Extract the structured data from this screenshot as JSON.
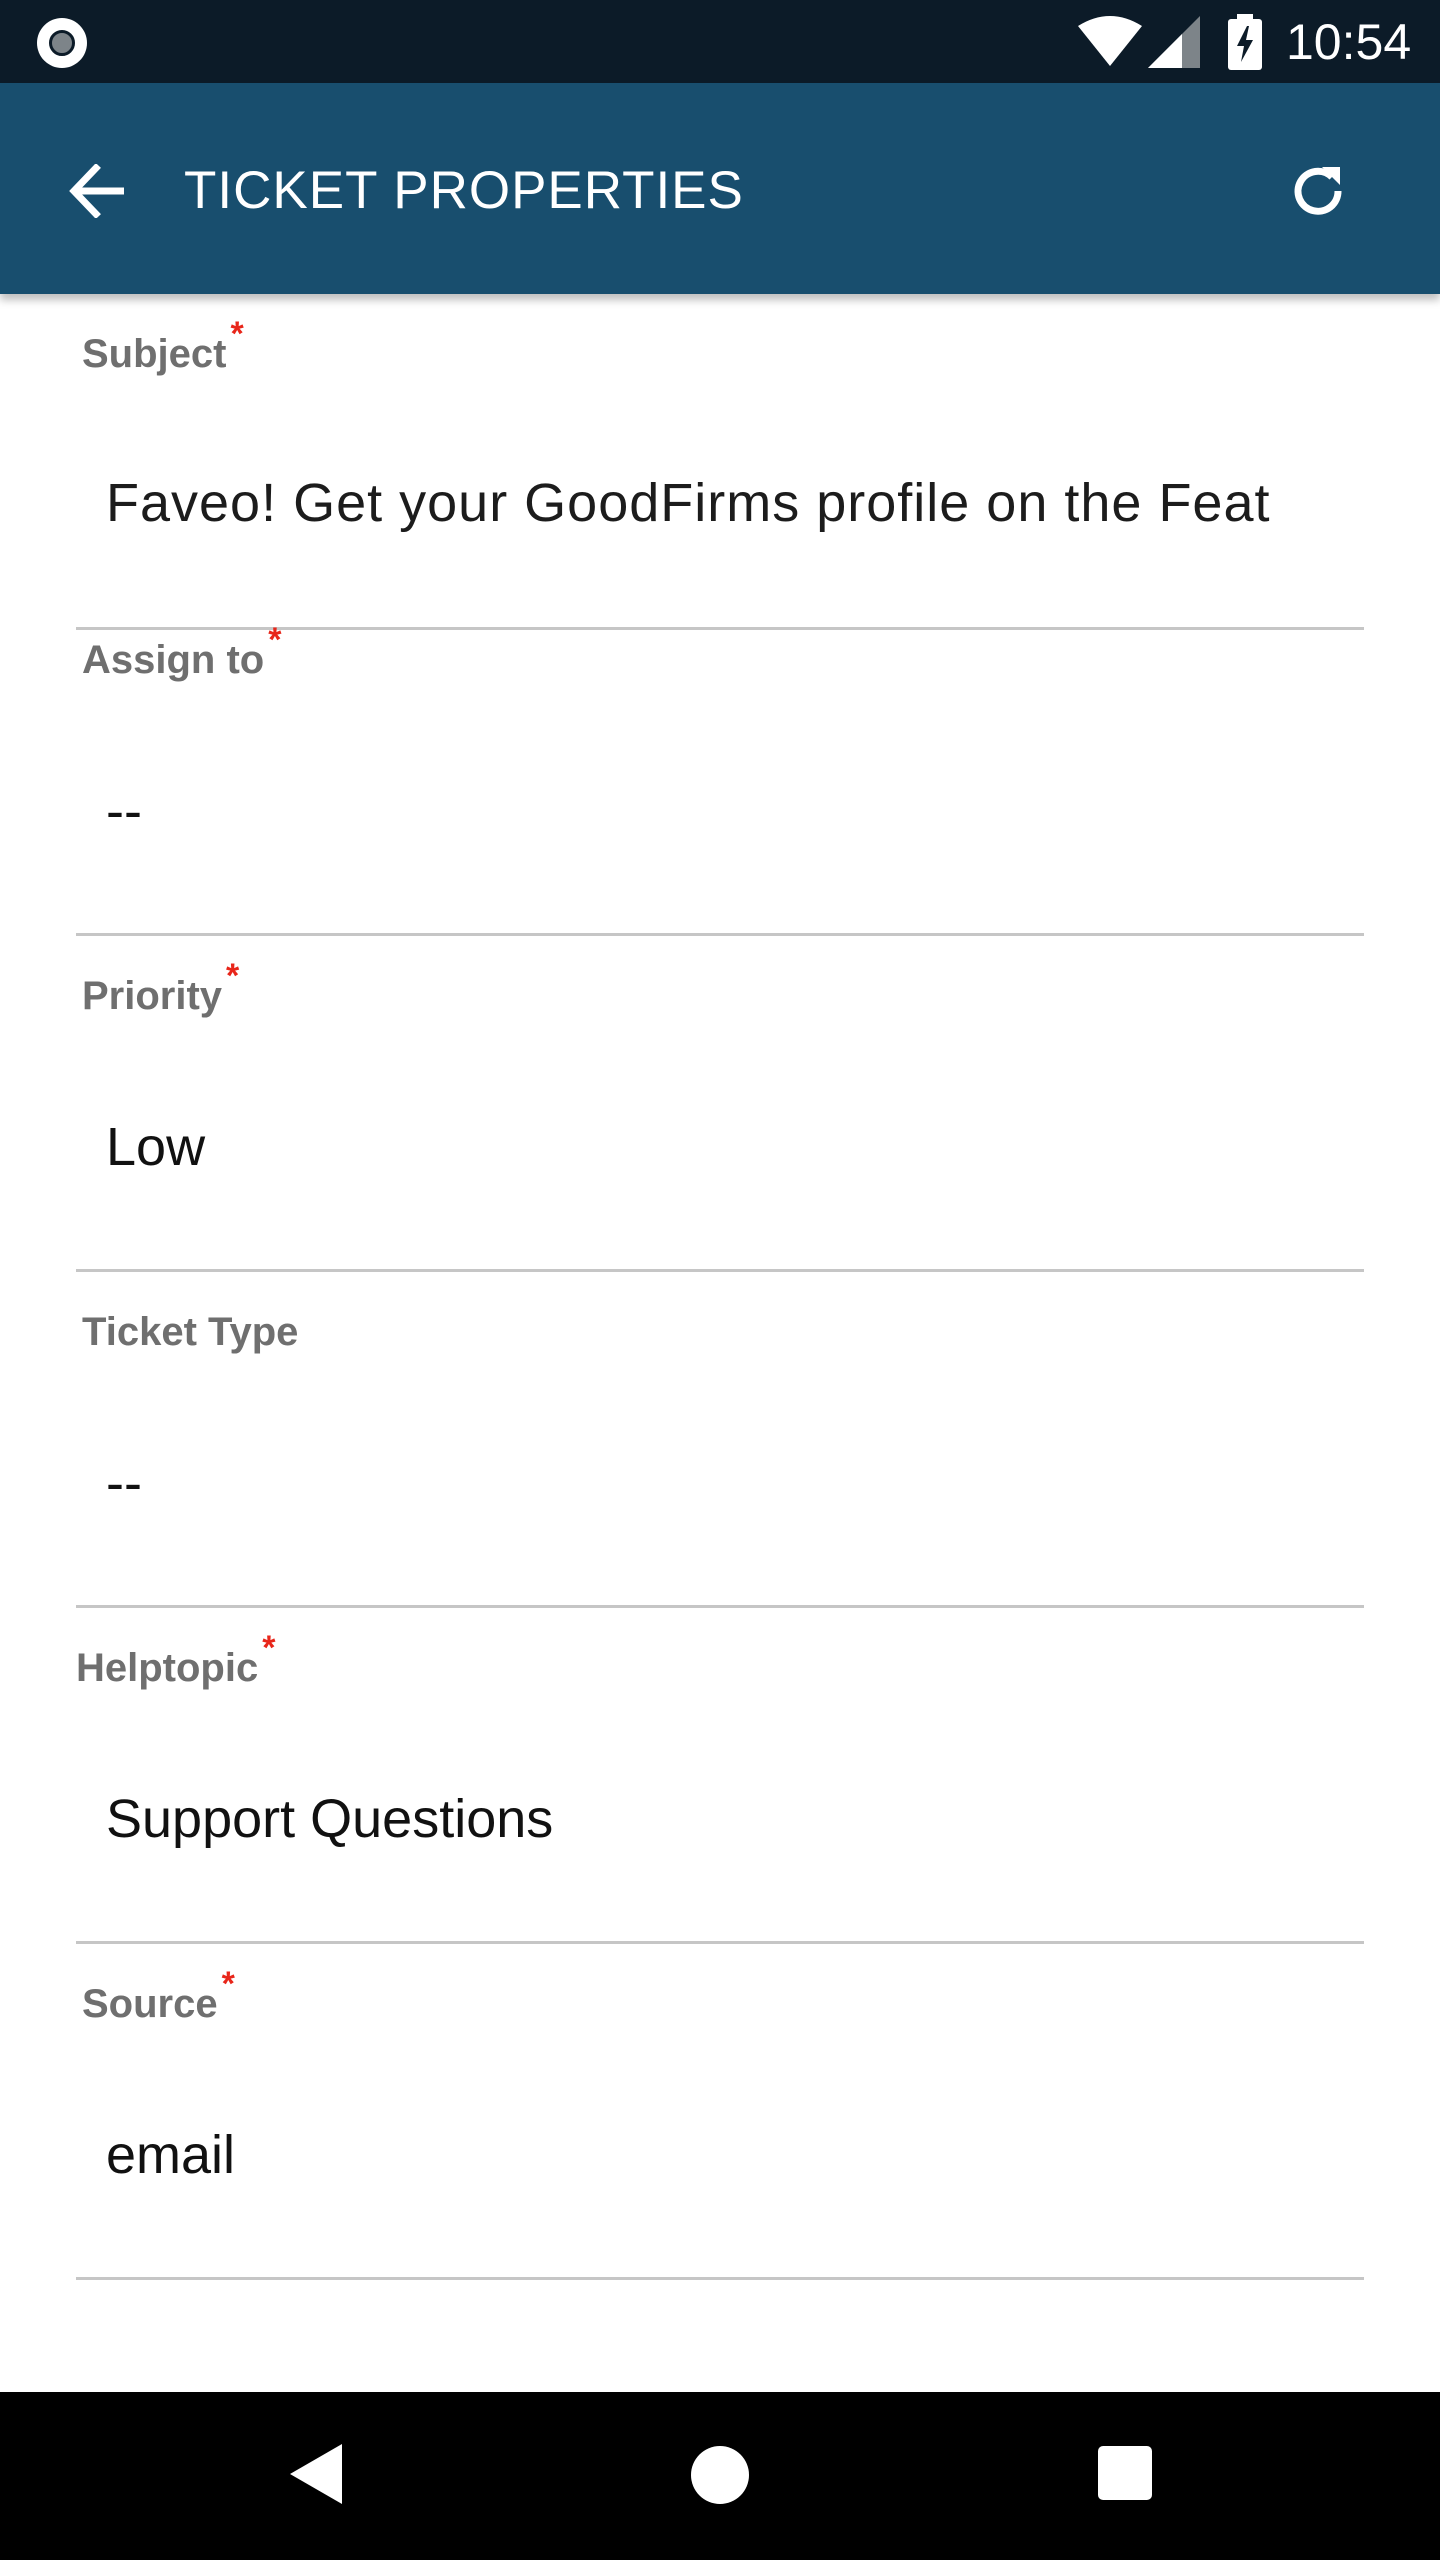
{
  "status_bar": {
    "time": "10:54",
    "icons": [
      "screen-record-icon",
      "wifi-icon",
      "signal-icon",
      "battery-charging-icon"
    ]
  },
  "app_bar": {
    "title": "TICKET PROPERTIES",
    "back_icon": "arrow-left-icon",
    "refresh_icon": "refresh-icon",
    "background": "#184e6e"
  },
  "form": {
    "fields": [
      {
        "label": "Subject",
        "required": true,
        "value": "Faveo! Get your GoodFirms profile on the Feat"
      },
      {
        "label": "Assign to",
        "required": true,
        "value": "--"
      },
      {
        "label": "Priority",
        "required": true,
        "value": "Low"
      },
      {
        "label": "Ticket Type",
        "required": false,
        "value": "--"
      },
      {
        "label": "Helptopic",
        "required": true,
        "value": "Support Questions"
      },
      {
        "label": "Source",
        "required": true,
        "value": "email"
      }
    ],
    "required_marker": "*",
    "required_color": "#e8261a"
  },
  "nav_bar": {
    "icons": [
      "nav-back-icon",
      "nav-home-icon",
      "nav-recents-icon"
    ]
  }
}
